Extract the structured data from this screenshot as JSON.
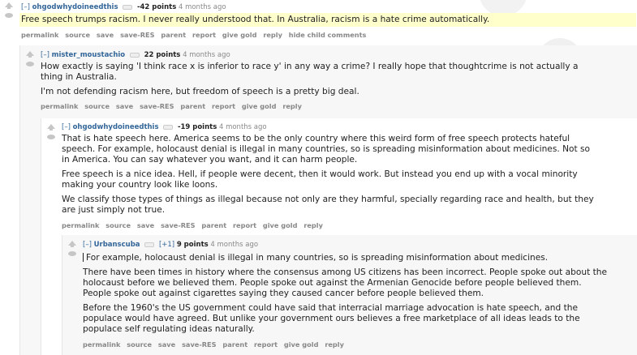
{
  "comments": [
    {
      "expand": "[–]",
      "author": "ohgodwhydoineedthis",
      "score": "-42 points",
      "time": "4 months ago",
      "paragraphs": [
        "Free speech trumps racism. I never really understood that. In Australia, racism is a hate crime automatically."
      ],
      "buttons": [
        "permalink",
        "source",
        "save",
        "save-RES",
        "parent",
        "report",
        "give gold",
        "reply",
        "hide child comments"
      ]
    },
    {
      "expand": "[–]",
      "author": "mister_moustachio",
      "score": "22 points",
      "time": "4 months ago",
      "paragraphs": [
        "How exactly is saying 'I think race x is inferior to race y' in any way a crime? I really hope that thoughtcrime is not actually a thing in Australia.",
        "I'm not defending racism here, but freedom of speech is a pretty big deal."
      ],
      "buttons": [
        "permalink",
        "source",
        "save",
        "save-RES",
        "parent",
        "report",
        "give gold",
        "reply"
      ]
    },
    {
      "expand": "[–]",
      "author": "ohgodwhydoineedthis",
      "score": "-19 points",
      "time": "4 months ago",
      "paragraphs": [
        "That is hate speech here. America seems to be the only country where this weird form of free speech protects hateful speech. For example, holocaust denial is illegal in many countries, so is spreading misinformation about medicines. Not so in America. You can say whatever you want, and it can harm people.",
        "Free speech is a nice idea. Hell, if people were decent, then it would work. But instead you end up with a vocal minority making your country look like loons.",
        "We classify those types of things as illegal because not only are they harmful, specially regarding race and health, but they are just simply not true."
      ],
      "buttons": [
        "permalink",
        "source",
        "save",
        "save-RES",
        "parent",
        "report",
        "give gold",
        "reply"
      ]
    },
    {
      "expand": "[–]",
      "author": "Urbanscuba",
      "extra": "[+1]",
      "score": "9 points",
      "time": "4 months ago",
      "paragraphs": [
        "For example, holocaust denial is illegal in many countries, so is spreading misinformation about medicines.",
        "There have been times in history where the consensus among US citizens has been incorrect. People spoke out about the holocaust before we believed them. People spoke out against the Armenian Genocide before people believed them. People spoke out against cigarettes saying they caused cancer before people believed them.",
        "Before the 1960's the US government could have said that interracial marriage advocation is hate speech, and the populace would have agreed. But unlike your government ours believes a free marketplace of all ideas leads to the populace self regulating ideas naturally."
      ],
      "buttons": [
        "permalink",
        "source",
        "save",
        "save-RES",
        "parent",
        "report",
        "give gold",
        "reply"
      ]
    }
  ],
  "colors": {
    "author": "#336699",
    "meta": "#888888",
    "highlight": "#ffffcc",
    "child_bg": "#f7f7f8"
  },
  "icons": [
    "upvote-icon",
    "downvote-icon",
    "flair-icon"
  ]
}
